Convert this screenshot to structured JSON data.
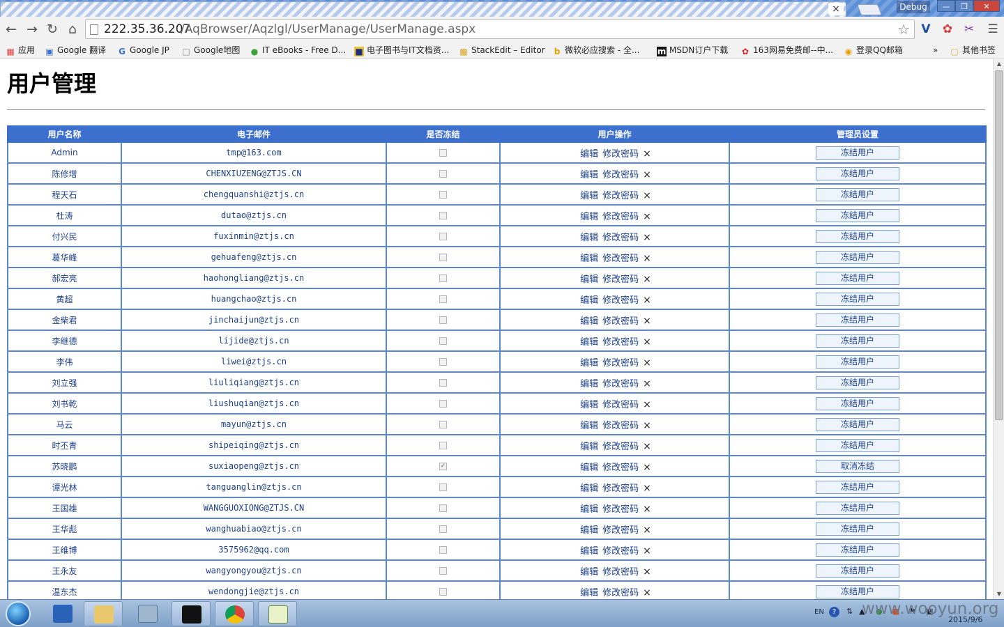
{
  "browser": {
    "debug_label": "Debug",
    "tab_close": "×",
    "url_host": "222.35.36.207",
    "url_path": "/AqBrowser/Aqzlgl/UserManage/UserManage.aspx"
  },
  "bookmarks": [
    {
      "label": "应用",
      "icon": "apps-grid-icon"
    },
    {
      "label": "Google 翻译",
      "icon": "translate-icon"
    },
    {
      "label": "Google JP",
      "icon": "google-icon"
    },
    {
      "label": "Google地图",
      "icon": "page-icon"
    },
    {
      "label": "IT eBooks - Free D...",
      "icon": "green-dot-icon"
    },
    {
      "label": "电子图书与IT文档资...",
      "icon": "book-icon"
    },
    {
      "label": "StackEdit – Editor",
      "icon": "stackedit-icon"
    },
    {
      "label": "微软必应搜索 - 全...",
      "icon": "bing-icon"
    },
    {
      "label": "MSDN订户下载",
      "icon": "msdn-icon"
    },
    {
      "label": "163网易免费邮--中...",
      "icon": "netease-icon"
    },
    {
      "label": "登录QQ邮箱",
      "icon": "qq-icon"
    },
    {
      "label": "»",
      "icon": ""
    },
    {
      "label": "其他书签",
      "icon": "folder-icon"
    }
  ],
  "page": {
    "title": "用户管理"
  },
  "table": {
    "headers": [
      "用户名称",
      "电子邮件",
      "是否冻结",
      "用户操作",
      "管理员设置"
    ],
    "ops": {
      "edit": "编辑",
      "change_pwd": "修改密码",
      "delete": "×"
    },
    "rows": [
      {
        "name": "Admin",
        "email": "tmp@163.com",
        "frozen": false,
        "action": "冻结用户"
      },
      {
        "name": "陈修增",
        "email": "CHENXIUZENG@ZTJS.CN",
        "frozen": false,
        "action": "冻结用户"
      },
      {
        "name": "程天石",
        "email": "chengquanshi@ztjs.cn",
        "frozen": false,
        "action": "冻结用户"
      },
      {
        "name": "杜涛",
        "email": "dutao@ztjs.cn",
        "frozen": false,
        "action": "冻结用户"
      },
      {
        "name": "付兴民",
        "email": "fuxinmin@ztjs.cn",
        "frozen": false,
        "action": "冻结用户"
      },
      {
        "name": "葛华峰",
        "email": "gehuafeng@ztjs.cn",
        "frozen": false,
        "action": "冻结用户"
      },
      {
        "name": "郝宏亮",
        "email": "haohongliang@ztjs.cn",
        "frozen": false,
        "action": "冻结用户"
      },
      {
        "name": "黄超",
        "email": "huangchao@ztjs.cn",
        "frozen": false,
        "action": "冻结用户"
      },
      {
        "name": "金柴君",
        "email": "jinchaijun@ztjs.cn",
        "frozen": false,
        "action": "冻结用户"
      },
      {
        "name": "李继德",
        "email": "lijide@ztjs.cn",
        "frozen": false,
        "action": "冻结用户"
      },
      {
        "name": "李伟",
        "email": "liwei@ztjs.cn",
        "frozen": false,
        "action": "冻结用户"
      },
      {
        "name": "刘立强",
        "email": "liuliqiang@ztjs.cn",
        "frozen": false,
        "action": "冻结用户"
      },
      {
        "name": "刘书乾",
        "email": "liushuqian@ztjs.cn",
        "frozen": false,
        "action": "冻结用户"
      },
      {
        "name": "马云",
        "email": "mayun@ztjs.cn",
        "frozen": false,
        "action": "冻结用户"
      },
      {
        "name": "时丕青",
        "email": "shipeiqing@ztjs.cn",
        "frozen": false,
        "action": "冻结用户"
      },
      {
        "name": "苏晓鹏",
        "email": "suxiaopeng@ztjs.cn",
        "frozen": true,
        "action": "取消冻结"
      },
      {
        "name": "谭光林",
        "email": "tanguanglin@ztjs.cn",
        "frozen": false,
        "action": "冻结用户"
      },
      {
        "name": "王国雄",
        "email": "WANGGUOXIONG@ZTJS.CN",
        "frozen": false,
        "action": "冻结用户"
      },
      {
        "name": "王华彪",
        "email": "wanghuabiao@ztjs.cn",
        "frozen": false,
        "action": "冻结用户"
      },
      {
        "name": "王维博",
        "email": "3575962@qq.com",
        "frozen": false,
        "action": "冻结用户"
      },
      {
        "name": "王永友",
        "email": "wangyongyou@ztjs.cn",
        "frozen": false,
        "action": "冻结用户"
      },
      {
        "name": "温东杰",
        "email": "wendongjie@ztjs.cn",
        "frozen": false,
        "action": "冻结用户"
      }
    ]
  },
  "taskbar": {
    "lang": "EN",
    "help": "?",
    "watermark": "www.wooyun.org",
    "date": "2015/9/6",
    "apps": [
      "powershell-icon",
      "explorer-icon",
      "calculator-icon",
      "cmd-icon",
      "chrome-icon",
      "notepad-icon"
    ]
  },
  "colors": {
    "header_blue": "#3d6fcf",
    "border_blue": "#5b86d6",
    "link_blue": "#1c3f8c"
  }
}
